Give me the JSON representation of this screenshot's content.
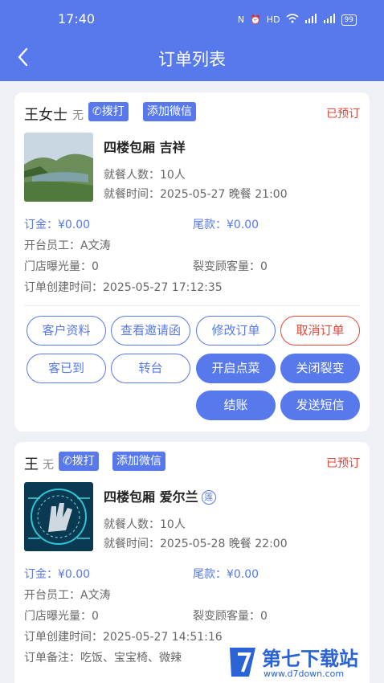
{
  "status_bar": {
    "time": "17:40",
    "icons": [
      "N",
      "⏰",
      "HD",
      "WiFi",
      "4G",
      "4G"
    ],
    "battery": "99"
  },
  "nav": {
    "title": "订单列表",
    "back_icon": "chevron-left-icon"
  },
  "orders": [
    {
      "name": "王女士",
      "gender": "无",
      "call_label": "拨打",
      "wechat_label": "添加微信",
      "status": "已预订",
      "room": "四楼包厢 吉祥",
      "guests": "就餐人数：10人",
      "dine_time": "就餐时间：2025-05-27 晚餐 21:00",
      "deposit": "订金：¥0.00",
      "balance": "尾款：¥0.00",
      "staff": "开台员工：A文涛",
      "exposure": "门店曝光量：0",
      "fission": "裂变顾客量：0",
      "created": "订单创建时间：2025-05-27 17:12:35",
      "buttons": {
        "customer": "客户资料",
        "invite": "查看邀请函",
        "modify": "修改订单",
        "cancel": "取消订单",
        "arrived": "客已到",
        "transfer": "转台",
        "order_food": "开启点菜",
        "close_fission": "关闭裂变",
        "checkout": "结账",
        "sms": "发送短信"
      }
    },
    {
      "name": "王",
      "gender": "无",
      "call_label": "拨打",
      "wechat_label": "添加微信",
      "status": "已预订",
      "room": "四楼包厢 爱尔兰",
      "room_badge": "莲",
      "guests": "就餐人数：10人",
      "dine_time": "就餐时间：2025-05-28 晚餐 22:00",
      "deposit": "订金：¥0.00",
      "balance": "尾款：¥0.00",
      "staff": "开台员工：A文涛",
      "exposure": "门店曝光量：0",
      "fission": "裂变顾客量：0",
      "created": "订单创建时间：2025-05-27 14:51:16",
      "remark": "订单备注：吃饭、宝宝椅、微辣"
    }
  ],
  "watermark": {
    "title": "第七下载站",
    "url": "www.d7down.com"
  }
}
